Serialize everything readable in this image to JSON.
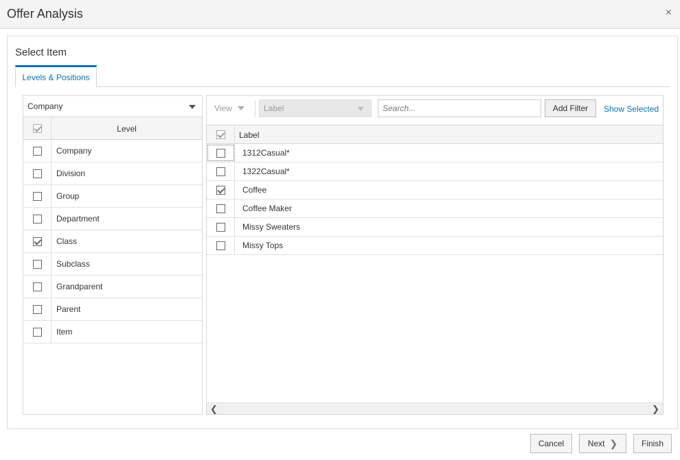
{
  "dialog": {
    "title": "Offer Analysis",
    "close_glyph": "×"
  },
  "section": {
    "title": "Select Item",
    "tab_label": "Levels & Positions"
  },
  "left_panel": {
    "selected_level": "Company",
    "column_header": "Level",
    "header_checked": true,
    "levels": [
      {
        "label": "Company",
        "checked": false
      },
      {
        "label": "Division",
        "checked": false
      },
      {
        "label": "Group",
        "checked": false
      },
      {
        "label": "Department",
        "checked": false
      },
      {
        "label": "Class",
        "checked": true
      },
      {
        "label": "Subclass",
        "checked": false
      },
      {
        "label": "Grandparent",
        "checked": false
      },
      {
        "label": "Parent",
        "checked": false
      },
      {
        "label": "Item",
        "checked": false
      }
    ]
  },
  "right_panel": {
    "view_label": "View",
    "label_select": "Label",
    "search_placeholder": "Search...",
    "add_filter_label": "Add Filter",
    "show_selected_label": "Show Selected",
    "column_header": "Label",
    "header_checked": true,
    "rows": [
      {
        "label": "1312Casual*",
        "checked": false,
        "focused": true
      },
      {
        "label": "1322Casual*",
        "checked": false,
        "focused": false
      },
      {
        "label": "Coffee",
        "checked": true,
        "focused": false
      },
      {
        "label": "Coffee Maker",
        "checked": false,
        "focused": false
      },
      {
        "label": "Missy Sweaters",
        "checked": false,
        "focused": false
      },
      {
        "label": "Missy Tops",
        "checked": false,
        "focused": false
      }
    ]
  },
  "footer": {
    "cancel_label": "Cancel",
    "next_label": "Next",
    "finish_label": "Finish"
  },
  "colors": {
    "accent": "#0b72b5"
  },
  "icons": {
    "close": "close-icon",
    "dropdown": "chevron-down-icon",
    "next": "chevron-right-icon",
    "scroll_left": "scroll-left-icon",
    "scroll_right": "scroll-right-icon"
  }
}
